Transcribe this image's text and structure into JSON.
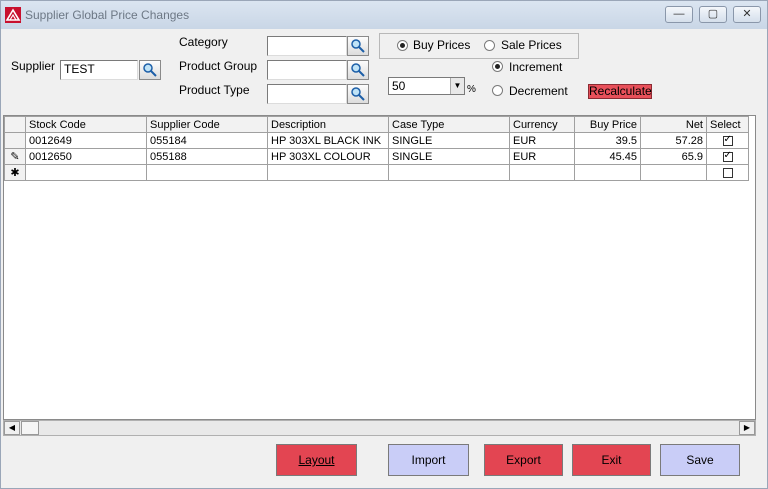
{
  "window": {
    "title": "Supplier Global Price Changes",
    "minimize": "—",
    "maximize": "▢",
    "close": "✕"
  },
  "filters": {
    "supplier_label": "Supplier",
    "supplier_value": "TEST",
    "category_label": "Category",
    "category_value": "",
    "product_group_label": "Product Group",
    "product_group_value": "",
    "product_type_label": "Product Type",
    "product_type_value": ""
  },
  "price_mode": {
    "buy_label": "Buy Prices",
    "sale_label": "Sale Prices",
    "selected": "buy"
  },
  "adjust": {
    "percent_value": "50",
    "percent_symbol": "%",
    "increment_label": "Increment",
    "decrement_label": "Decrement",
    "selected": "increment",
    "recalculate_label": "Recalculate"
  },
  "grid": {
    "columns": [
      "Stock Code",
      "Supplier Code",
      "Description",
      "Case Type",
      "Currency",
      "Buy Price",
      "Net",
      "Select"
    ],
    "rows": [
      {
        "marker": "",
        "stock_code": "0012649",
        "supplier_code": "055184",
        "description": "HP 303XL BLACK INK",
        "case_type": "SINGLE",
        "currency": "EUR",
        "buy_price": "39.5",
        "net": "57.28",
        "selected": true
      },
      {
        "marker": "✎",
        "stock_code": "0012650",
        "supplier_code": "055188",
        "description": "HP 303XL COLOUR",
        "case_type": "SINGLE",
        "currency": "EUR",
        "buy_price": "45.45",
        "net": "65.9",
        "selected": true
      }
    ],
    "new_row_marker": "✱"
  },
  "scrollbar": {
    "left": "◀",
    "right": "▶"
  },
  "buttons": {
    "layout": "Layout",
    "import": "Import",
    "export": "Export",
    "exit": "Exit",
    "save": "Save"
  },
  "colors": {
    "red_button": "#e34552",
    "blue_button": "#c9cdf7",
    "recalculate": "#e8505a"
  }
}
